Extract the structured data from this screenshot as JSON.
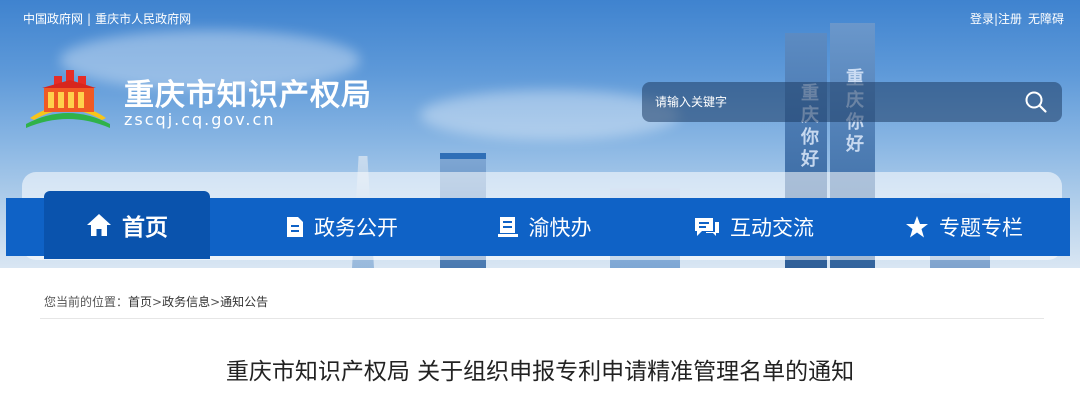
{
  "topbar": {
    "left_links": [
      "中国政府网",
      "重庆市人民政府网"
    ],
    "separator": "|",
    "login": "登录|注册",
    "accessibility": "无障碍"
  },
  "header": {
    "title": "重庆市知识产权局",
    "domain": "zscqj.cq.gov.cn"
  },
  "search": {
    "placeholder": "请输入关键字"
  },
  "banner_text": {
    "tower_left": "重庆你好",
    "tower_right": "重庆你好"
  },
  "nav": {
    "items": [
      {
        "label": "首页",
        "icon": "home-icon",
        "active": true
      },
      {
        "label": "政务公开",
        "icon": "document-icon",
        "active": false
      },
      {
        "label": "渝快办",
        "icon": "book-icon",
        "active": false
      },
      {
        "label": "互动交流",
        "icon": "chat-icon",
        "active": false
      },
      {
        "label": "专题专栏",
        "icon": "star-icon",
        "active": false
      }
    ]
  },
  "breadcrumb": {
    "prefix": "您当前的位置：",
    "items": [
      "首页",
      "政务信息",
      "通知公告"
    ],
    "separator": ">"
  },
  "article": {
    "title": "重庆市知识产权局 关于组织申报专利申请精准管理名单的通知"
  },
  "colors": {
    "nav_bg": "#0f62c6",
    "nav_active": "#0a53ad"
  }
}
